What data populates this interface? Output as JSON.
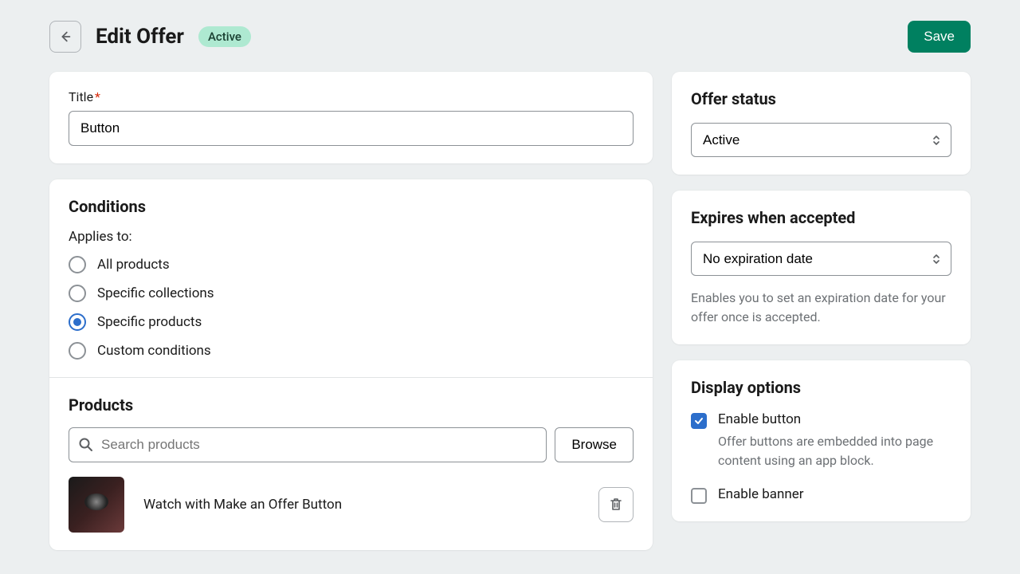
{
  "header": {
    "title": "Edit Offer",
    "badge": "Active",
    "save_label": "Save"
  },
  "title_field": {
    "label": "Title",
    "value": "Button"
  },
  "conditions": {
    "heading": "Conditions",
    "applies_label": "Applies to:",
    "options": [
      "All products",
      "Specific collections",
      "Specific products",
      "Custom conditions"
    ],
    "selected_index": 2
  },
  "products": {
    "heading": "Products",
    "search_placeholder": "Search products",
    "browse_label": "Browse",
    "items": [
      {
        "name": "Watch with Make an Offer Button"
      }
    ]
  },
  "status": {
    "heading": "Offer status",
    "value": "Active"
  },
  "expires": {
    "heading": "Expires when accepted",
    "value": "No expiration date",
    "help": "Enables you to set an expiration date for your offer once is accepted."
  },
  "display": {
    "heading": "Display options",
    "enable_button": {
      "label": "Enable button",
      "desc": "Offer buttons are embedded into page content using an app block.",
      "checked": true
    },
    "enable_banner": {
      "label": "Enable banner",
      "checked": false
    }
  }
}
